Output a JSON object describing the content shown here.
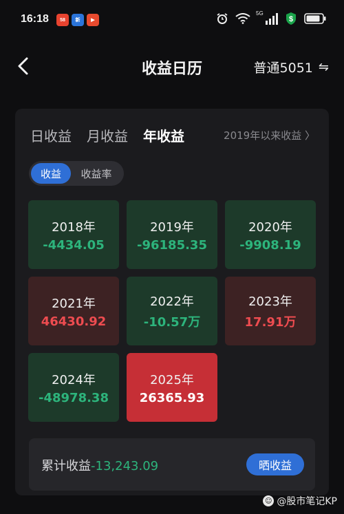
{
  "status_bar": {
    "time": "16:18",
    "app_icons": [
      {
        "name": "58-app-icon",
        "text": "58",
        "color": "#e8432f"
      },
      {
        "name": "news-app-icon",
        "text": "新",
        "color": "#2b74d9"
      },
      {
        "name": "video-app-icon",
        "text": "▶",
        "color": "#e84a2e"
      }
    ],
    "network": "5G",
    "battery_color": "#f2f2f2",
    "pay_icon_color": "#1aa34a"
  },
  "nav": {
    "title": "收益日历",
    "account": "普通5051",
    "switch_glyph": "⇋"
  },
  "tabs": [
    {
      "label": "日收益",
      "active": false
    },
    {
      "label": "月收益",
      "active": false
    },
    {
      "label": "年收益",
      "active": true
    }
  ],
  "since_link": "2019年以来收益 〉",
  "segment": {
    "items": [
      {
        "label": "收益",
        "active": true
      },
      {
        "label": "收益率",
        "active": false
      }
    ]
  },
  "years": [
    {
      "year": "2018年",
      "value": "-4434.05",
      "kind": "loss"
    },
    {
      "year": "2019年",
      "value": "-96185.35",
      "kind": "loss"
    },
    {
      "year": "2020年",
      "value": "-9908.19",
      "kind": "loss"
    },
    {
      "year": "2021年",
      "value": "46430.92",
      "kind": "gain"
    },
    {
      "year": "2022年",
      "value": "-10.57万",
      "kind": "loss"
    },
    {
      "year": "2023年",
      "value": "17.91万",
      "kind": "gain"
    },
    {
      "year": "2024年",
      "value": "-48978.38",
      "kind": "loss"
    },
    {
      "year": "2025年",
      "value": "26365.93",
      "kind": "highlight"
    }
  ],
  "summary": {
    "label": "累计收益",
    "value": "-13,243.09",
    "share_button": "晒收益"
  },
  "watermark": "@股市笔记KP",
  "colors": {
    "accent_blue": "#2f6fd6",
    "loss_green": "#2db47c",
    "gain_red": "#ee4c50",
    "highlight_red": "#c62f36"
  }
}
